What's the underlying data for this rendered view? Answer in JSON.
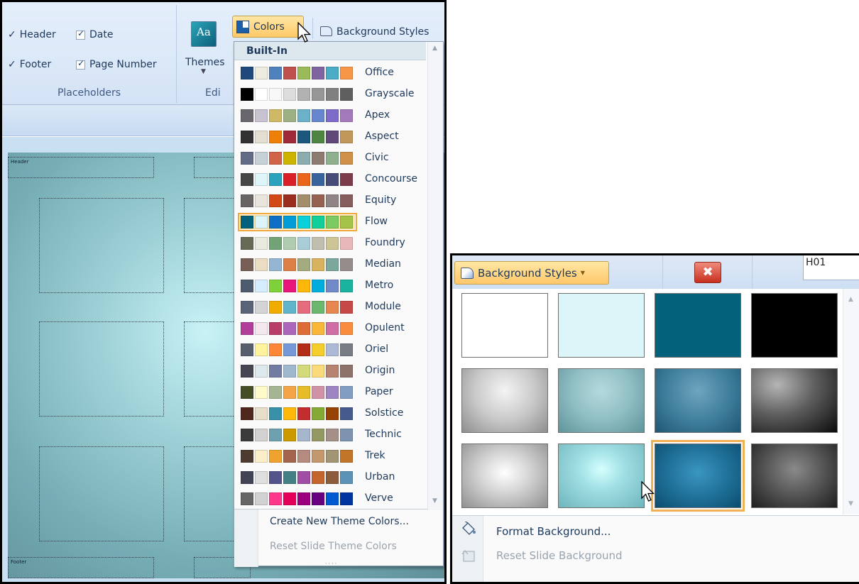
{
  "left_panel": {
    "ribbon": {
      "header_label": "Header",
      "date_label": "Date",
      "footer_label": "Footer",
      "page_number_label": "Page Number",
      "placeholders_group": "Placeholders",
      "themes_icon_text": "Aa",
      "themes_label": "Themes",
      "edit_group": "Edi",
      "colors_label": "Colors",
      "background_styles_label": "Background Styles"
    },
    "slide": {
      "header_placeholder": "Header",
      "footer_placeholder": "Footer"
    },
    "colors_menu": {
      "heading": "Built-In",
      "schemes": [
        {
          "name": "Office",
          "colors": [
            "#1f497d",
            "#eeece1",
            "#4f81bd",
            "#c0504d",
            "#9bbb59",
            "#8064a2",
            "#4bacc6",
            "#f79646"
          ]
        },
        {
          "name": "Grayscale",
          "colors": [
            "#000000",
            "#ffffff",
            "#f8f8f8",
            "#dddddd",
            "#b2b2b2",
            "#969696",
            "#808080",
            "#5f5f5f"
          ]
        },
        {
          "name": "Apex",
          "colors": [
            "#69676d",
            "#c9c2d1",
            "#ceb966",
            "#9cb084",
            "#6bb1c9",
            "#6585cf",
            "#7e6bc9",
            "#a379bb"
          ]
        },
        {
          "name": "Aspect",
          "colors": [
            "#323232",
            "#e3ded1",
            "#f07f09",
            "#9f2936",
            "#1b587c",
            "#4e8542",
            "#604878",
            "#c19859"
          ]
        },
        {
          "name": "Civic",
          "colors": [
            "#646b86",
            "#c5d1d7",
            "#d16349",
            "#ccb400",
            "#8cadae",
            "#8c7b70",
            "#8fb08c",
            "#d19049"
          ]
        },
        {
          "name": "Concourse",
          "colors": [
            "#464646",
            "#def5fa",
            "#2da2bf",
            "#da1f28",
            "#eb641b",
            "#39639d",
            "#474b78",
            "#7d3c4a"
          ]
        },
        {
          "name": "Equity",
          "colors": [
            "#696464",
            "#e9e5dc",
            "#d34817",
            "#9b2d1f",
            "#a28e6a",
            "#956251",
            "#918485",
            "#855d5d"
          ]
        },
        {
          "name": "Flow",
          "colors": [
            "#04617b",
            "#dbf5f9",
            "#0f6fc6",
            "#009dd9",
            "#0bd0d9",
            "#10cf9b",
            "#7cca62",
            "#a5c249"
          ]
        },
        {
          "name": "Foundry",
          "colors": [
            "#676a55",
            "#eaebde",
            "#72a376",
            "#b0ccb0",
            "#a8cdd7",
            "#c0beaf",
            "#cec597",
            "#e8b7b7"
          ]
        },
        {
          "name": "Median",
          "colors": [
            "#775f55",
            "#ebddc3",
            "#94b6d2",
            "#dd8047",
            "#a5ab81",
            "#d8b25c",
            "#7ba79d",
            "#968c8c"
          ]
        },
        {
          "name": "Metro",
          "colors": [
            "#4e5b6f",
            "#d6ecff",
            "#7fd13b",
            "#ea157a",
            "#feb80a",
            "#00addc",
            "#738ac8",
            "#1ab39f"
          ]
        },
        {
          "name": "Module",
          "colors": [
            "#5a6378",
            "#d4d4d6",
            "#f0ad00",
            "#60b5cc",
            "#e66c7d",
            "#6bb76d",
            "#e88651",
            "#c64847"
          ]
        },
        {
          "name": "Opulent",
          "colors": [
            "#b13f9a",
            "#f4e7ed",
            "#b83d68",
            "#ac66bb",
            "#de6c36",
            "#f9b639",
            "#cf6da4",
            "#fa8d3d"
          ]
        },
        {
          "name": "Oriel",
          "colors": [
            "#575f6d",
            "#fff39d",
            "#fe8637",
            "#7598d9",
            "#b32c16",
            "#f5cd2d",
            "#aebad5",
            "#777c84"
          ]
        },
        {
          "name": "Origin",
          "colors": [
            "#464653",
            "#dde9ec",
            "#727ca3",
            "#9fb8cd",
            "#d2da7a",
            "#fada7a",
            "#b88472",
            "#8e736a"
          ]
        },
        {
          "name": "Paper",
          "colors": [
            "#444d26",
            "#fefac9",
            "#a5b592",
            "#f3a447",
            "#e7bc29",
            "#d092a7",
            "#9c85c0",
            "#809ec2"
          ]
        },
        {
          "name": "Solstice",
          "colors": [
            "#4f271c",
            "#e7dec9",
            "#3891a7",
            "#feb80a",
            "#c32d2e",
            "#84aa33",
            "#964305",
            "#475a8d"
          ]
        },
        {
          "name": "Technic",
          "colors": [
            "#3b3b3b",
            "#d4d2d0",
            "#6ea0b0",
            "#cc9900",
            "#a6b6cd",
            "#949963",
            "#a49089",
            "#7d93b0"
          ]
        },
        {
          "name": "Trek",
          "colors": [
            "#4e3b30",
            "#fbeec9",
            "#f0a22e",
            "#a5644e",
            "#b58b80",
            "#c3986d",
            "#a19574",
            "#c17529"
          ]
        },
        {
          "name": "Urban",
          "colors": [
            "#424456",
            "#dedede",
            "#53548a",
            "#438086",
            "#a04da3",
            "#c4652d",
            "#8b5d3d",
            "#5c92b5"
          ]
        },
        {
          "name": "Verve",
          "colors": [
            "#666666",
            "#d2d2d2",
            "#ff388c",
            "#e40059",
            "#9c007f",
            "#68007f",
            "#005bd3",
            "#00349e"
          ]
        }
      ],
      "selected_scheme": "Flow",
      "create_new": "Create New Theme Colors...",
      "reset": "Reset Slide Theme Colors"
    }
  },
  "right_panel": {
    "background_styles_label": "Background Styles",
    "close_icon": "✖",
    "field_text": "H01",
    "styles": [
      {
        "style": "background:#ffffff"
      },
      {
        "style": "background:#dbf5f9"
      },
      {
        "style": "background:#04617b"
      },
      {
        "style": "background:#000000"
      },
      {
        "style": "background:radial-gradient(ellipse at 50% 35%,#f4f4f4 0%,#c9c9c9 50%,#8e8e8e 100%)"
      },
      {
        "style": "background:radial-gradient(ellipse at 50% 35%,#b6dadd 0%,#8fbec3 50%,#5f959c 100%)"
      },
      {
        "style": "background:radial-gradient(ellipse at 50% 35%,#6fa4bd 0%,#3d7d9b 55%,#1f5674 100%)"
      },
      {
        "style": "background:radial-gradient(ellipse at 30% 25%,#b5b5b5 0%,#5e5e5e 45%,#0b0b0b 100%)"
      },
      {
        "style": "background:radial-gradient(ellipse at 50% 45%,#ffffff 0%,#d6d6d6 40%,#8f8f8f 100%)"
      },
      {
        "style": "background:radial-gradient(ellipse at 50% 40%,#d6ffff 0%,#a3e2e6 35%,#6fb5bc 100%)"
      },
      {
        "style": "background:radial-gradient(ellipse at 50% 45%,#3a96c1 0%,#1e6e96 55%,#0d4d6e 100%)"
      },
      {
        "style": "background:radial-gradient(ellipse at 50% 40%,#8a8a8a 0%,#4e4e4e 55%,#1e1e1e 100%)"
      }
    ],
    "selected_style": 10,
    "format_background": "Format Background...",
    "reset_background": "Reset Slide Background"
  }
}
